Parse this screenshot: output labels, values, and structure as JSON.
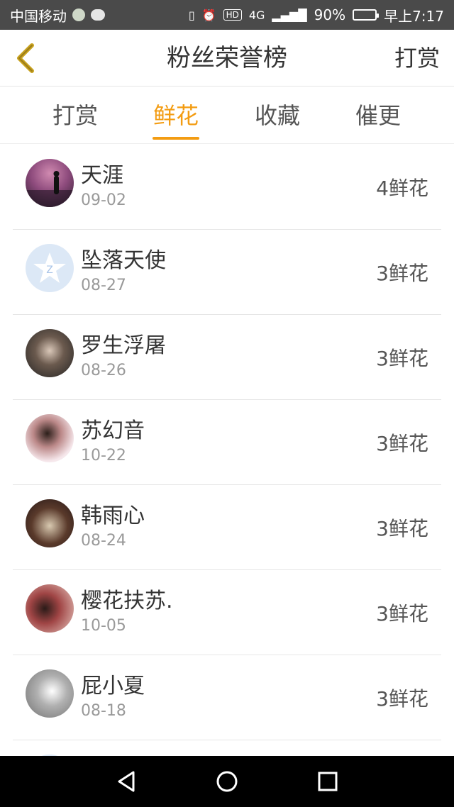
{
  "status_bar": {
    "carrier": "中国移动",
    "battery_percent": "90%",
    "time": "早上7:17",
    "network": "4G",
    "hd_badge": "HD",
    "battery_level": 0.9
  },
  "nav": {
    "title": "粉丝荣誉榜",
    "action": "打赏"
  },
  "tabs": [
    {
      "label": "打赏",
      "active": false
    },
    {
      "label": "鲜花",
      "active": true
    },
    {
      "label": "收藏",
      "active": false
    },
    {
      "label": "催更",
      "active": false
    }
  ],
  "fans": [
    {
      "name": "天涯",
      "date": "09-02",
      "count": "4鲜花"
    },
    {
      "name": "坠落天使",
      "date": "08-27",
      "count": "3鲜花"
    },
    {
      "name": "罗生浮屠",
      "date": "08-26",
      "count": "3鲜花"
    },
    {
      "name": "苏幻音",
      "date": "10-22",
      "count": "3鲜花"
    },
    {
      "name": "韩雨心",
      "date": "08-24",
      "count": "3鲜花"
    },
    {
      "name": "樱花扶苏.",
      "date": "10-05",
      "count": "3鲜花"
    },
    {
      "name": "屁小夏",
      "date": "08-18",
      "count": "3鲜花"
    },
    {
      "name": "",
      "date": "",
      "count": ""
    }
  ],
  "colors": {
    "accent": "#f39c12",
    "status_bar_bg": "#4a4a4a",
    "back_icon": "#c8a21e"
  },
  "icons": {
    "back": "chevron-left-icon",
    "sys_back": "triangle-back-icon",
    "sys_home": "circle-home-icon",
    "sys_recent": "square-recent-icon"
  }
}
